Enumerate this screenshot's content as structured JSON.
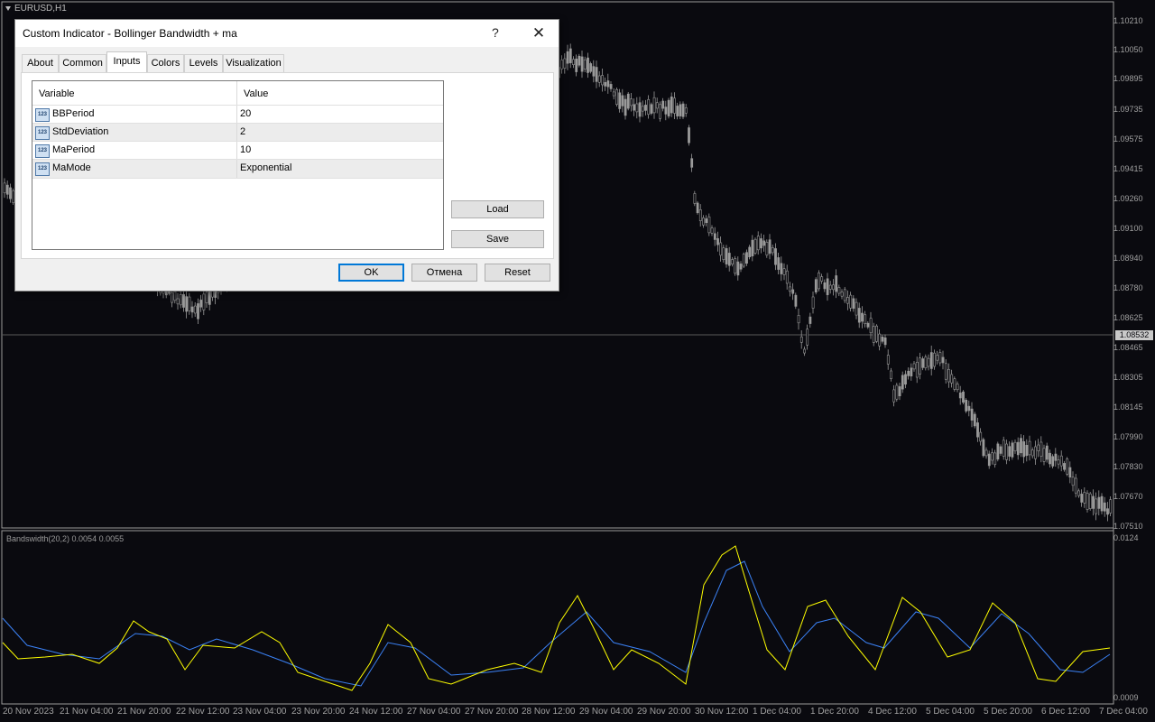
{
  "chart": {
    "symbol": "EURUSD,H1",
    "current_price": "1.08532",
    "price_scale": [
      "1.10210",
      "1.10050",
      "1.09895",
      "1.09735",
      "1.09575",
      "1.09415",
      "1.09260",
      "1.09100",
      "1.08940",
      "1.08780",
      "1.08625",
      "1.08465",
      "1.08305",
      "1.08145",
      "1.07990",
      "1.07830",
      "1.07670",
      "1.07510"
    ],
    "time_axis": [
      "20 Nov 2023",
      "21 Nov 04:00",
      "21 Nov 20:00",
      "22 Nov 12:00",
      "23 Nov 04:00",
      "23 Nov 20:00",
      "24 Nov 12:00",
      "27 Nov 04:00",
      "27 Nov 20:00",
      "28 Nov 12:00",
      "29 Nov 04:00",
      "29 Nov 20:00",
      "30 Nov 12:00",
      "1 Dec 04:00",
      "1 Dec 20:00",
      "4 Dec 12:00",
      "5 Dec 04:00",
      "5 Dec 20:00",
      "6 Dec 12:00",
      "7 Dec 04:00"
    ],
    "colors": {
      "background": "#0a0a0f",
      "candle": "#9a9a9a",
      "bandwidth": "#ffff00",
      "ma": "#3b82f6"
    }
  },
  "indicator": {
    "label": "Bandswidth(20,2) 0.0054 0.0055",
    "scale_top": "0.0124",
    "scale_bottom": "0.0009"
  },
  "dialog": {
    "title": "Custom Indicator - Bollinger Bandwidth + ma",
    "help": "?",
    "tabs": [
      {
        "label": "About"
      },
      {
        "label": "Common"
      },
      {
        "label": "Inputs",
        "active": true
      },
      {
        "label": "Colors"
      },
      {
        "label": "Levels"
      },
      {
        "label": "Visualization"
      }
    ],
    "grid": {
      "col_variable": "Variable",
      "col_value": "Value",
      "rows": [
        {
          "variable": "BBPeriod",
          "value": "20"
        },
        {
          "variable": "StdDeviation",
          "value": "2"
        },
        {
          "variable": "MaPeriod",
          "value": "10"
        },
        {
          "variable": "MaMode",
          "value": "Exponential"
        }
      ],
      "row_icon": "123-param-icon"
    },
    "buttons": {
      "load": "Load",
      "save": "Save",
      "ok": "OK",
      "cancel": "Отмена",
      "reset": "Reset"
    }
  }
}
